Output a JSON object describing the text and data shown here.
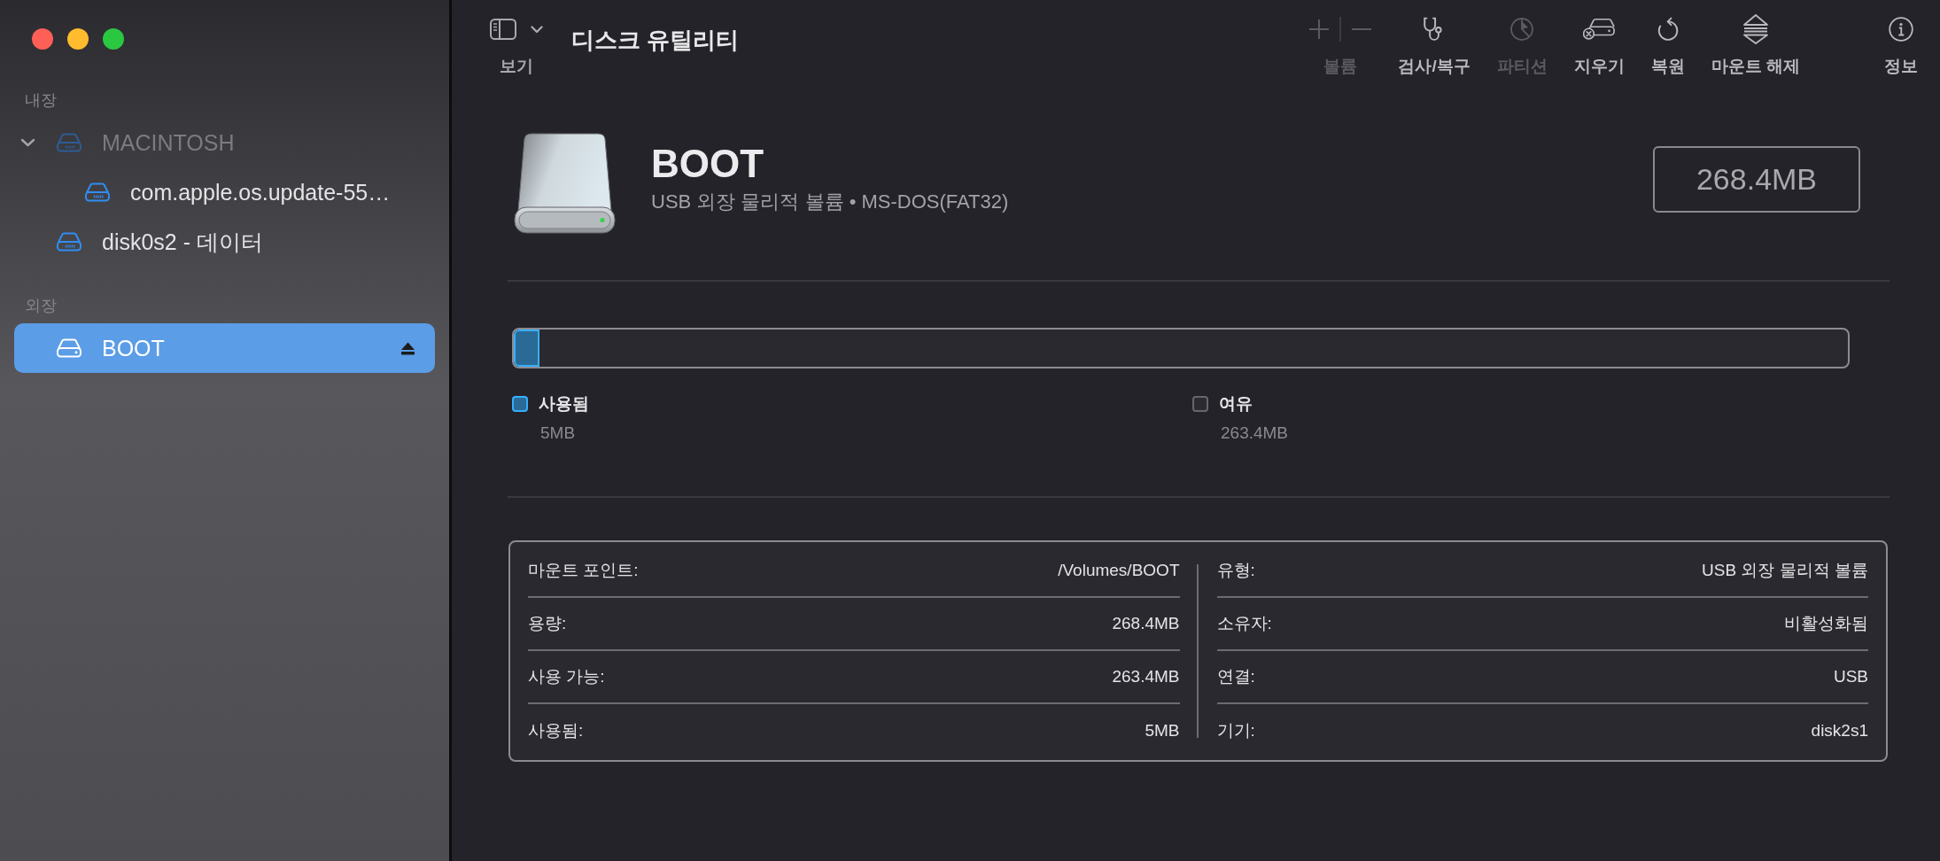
{
  "sidebar": {
    "sections": [
      {
        "heading": "내장",
        "items": [
          {
            "name": "MACINTOSH",
            "kind": "internal_volume",
            "selected": false,
            "disabled": true,
            "ejectable": false,
            "expanded": true,
            "children": [
              {
                "name": "com.apple.os.update-55…",
                "kind": "internal_volume",
                "selected": false,
                "disabled": false,
                "ejectable": false
              }
            ]
          },
          {
            "name": "disk0s2 - 데이터",
            "kind": "internal_volume",
            "selected": false,
            "disabled": false,
            "ejectable": false
          }
        ]
      },
      {
        "heading": "외장",
        "items": [
          {
            "name": "BOOT",
            "kind": "external_volume",
            "selected": true,
            "disabled": false,
            "ejectable": true
          }
        ]
      }
    ]
  },
  "toolbar": {
    "view_button": {
      "label": "보기"
    },
    "title": "디스크 유틸리티",
    "actions": [
      {
        "kind": "volume",
        "label": "볼륨",
        "disabled": true
      },
      {
        "kind": "first_aid",
        "label": "검사/복구",
        "disabled": false
      },
      {
        "kind": "partition",
        "label": "파티션",
        "disabled": true
      },
      {
        "kind": "erase",
        "label": "지우기",
        "disabled": false
      },
      {
        "kind": "restore",
        "label": "복원",
        "disabled": false
      },
      {
        "kind": "unmount",
        "label": "마운트 해제",
        "disabled": false
      }
    ],
    "info_button": {
      "label": "정보"
    }
  },
  "volume": {
    "name": "BOOT",
    "description": "USB 외장 물리적 볼륨 • MS-DOS(FAT32)",
    "capacity": "268.4MB"
  },
  "usage": {
    "level": 0.019,
    "legend": [
      {
        "label": "사용됨",
        "value": "5MB",
        "color": "#2a6a96"
      },
      {
        "label": "여유",
        "value": "263.4MB",
        "color": "#2c2b31"
      }
    ]
  },
  "info": {
    "columns": [
      {
        "rows": [
          {
            "label": "마운트 포인트:",
            "value": "/Volumes/BOOT"
          },
          {
            "label": "용량:",
            "value": "268.4MB"
          },
          {
            "label": "사용 가능:",
            "value": "263.4MB"
          },
          {
            "label": "사용됨:",
            "value": "5MB"
          }
        ]
      },
      {
        "rows": [
          {
            "label": "유형:",
            "value": "USB 외장 물리적 볼륨"
          },
          {
            "label": "소유자:",
            "value": "비활성화됨"
          },
          {
            "label": "연결:",
            "value": "USB"
          },
          {
            "label": "기기:",
            "value": "disk2s1"
          }
        ]
      }
    ]
  }
}
